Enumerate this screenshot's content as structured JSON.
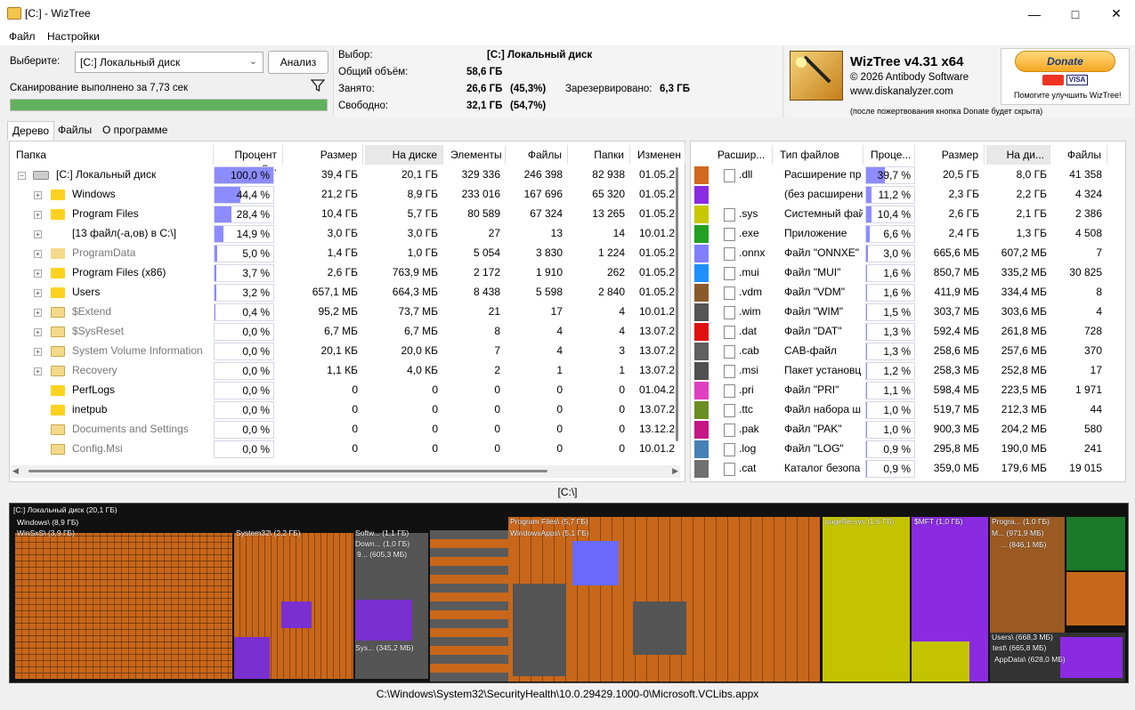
{
  "window": {
    "title": "[C:]  - WizTree"
  },
  "menu": [
    "Файл",
    "Настройки"
  ],
  "top": {
    "select_label": "Выберите:",
    "drive": "[C:] Локальный диск",
    "analyze": "Анализ",
    "scan_status": "Сканирование выполнено за 7,73 сек",
    "progress": 1.0
  },
  "info": {
    "sel_label": "Выбор:",
    "sel_value": "[C:]  Локальный диск",
    "total_label": "Общий объём:",
    "total": "58,6 ГБ",
    "used_label": "Занято:",
    "used": "26,6 ГБ",
    "used_pct": "(45,3%)",
    "reserved_label": "Зарезервировано:",
    "reserved": "6,3 ГБ",
    "free_label": "Свободно:",
    "free": "32,1 ГБ",
    "free_pct": "(54,7%)"
  },
  "brand": {
    "name": "WizTree v4.31 x64",
    "copy": "© 2026 Antibody Software",
    "site": "www.diskanalyzer.com",
    "donate": "Donate",
    "donate_help": "Помогите улучшить WizTree!",
    "donate_note": "(после пожертвования кнопка Donate будет скрыта)"
  },
  "tabs": [
    "Дерево",
    "Файлы",
    "О программе"
  ],
  "tree_headers": [
    "Папка",
    "Процент о...",
    "Размер",
    "На диске",
    "Элементы",
    "Файлы",
    "Папки",
    "Изменен"
  ],
  "tree_rows": [
    {
      "name": "[C:] Локальный диск",
      "pct": "100,0 %",
      "p": 1.0,
      "size": "39,4 ГБ",
      "disk": "20,1 ГБ",
      "items": "329 336",
      "files": "246 398",
      "folders": "82 938",
      "mod": "01.05.2",
      "type": "drive",
      "level": 0
    },
    {
      "name": "Windows",
      "pct": "44,4 %",
      "p": 0.444,
      "size": "21,2 ГБ",
      "disk": "8,9 ГБ",
      "items": "233 016",
      "files": "167 696",
      "folders": "65 320",
      "mod": "01.05.2",
      "type": "folder",
      "level": 1
    },
    {
      "name": "Program Files",
      "pct": "28,4 %",
      "p": 0.284,
      "size": "10,4 ГБ",
      "disk": "5,7 ГБ",
      "items": "80 589",
      "files": "67 324",
      "folders": "13 265",
      "mod": "01.05.2",
      "type": "folder",
      "level": 1
    },
    {
      "name": "[13 файл(-а,ов) в C:\\]",
      "pct": "14,9 %",
      "p": 0.149,
      "size": "3,0 ГБ",
      "disk": "3,0 ГБ",
      "items": "27",
      "files": "13",
      "folders": "14",
      "mod": "10.01.2",
      "type": "files",
      "level": 1
    },
    {
      "name": "ProgramData",
      "pct": "5,0 %",
      "p": 0.05,
      "size": "1,4 ГБ",
      "disk": "1,0 ГБ",
      "items": "5 054",
      "files": "3 830",
      "folders": "1 224",
      "mod": "01.05.2",
      "type": "hidden",
      "level": 1
    },
    {
      "name": "Program Files (x86)",
      "pct": "3,7 %",
      "p": 0.037,
      "size": "2,6 ГБ",
      "disk": "763,9 МБ",
      "items": "2 172",
      "files": "1 910",
      "folders": "262",
      "mod": "01.05.2",
      "type": "folder",
      "level": 1
    },
    {
      "name": "Users",
      "pct": "3,2 %",
      "p": 0.032,
      "size": "657,1 МБ",
      "disk": "664,3 МБ",
      "items": "8 438",
      "files": "5 598",
      "folders": "2 840",
      "mod": "01.05.2",
      "type": "folder",
      "level": 1
    },
    {
      "name": "$Extend",
      "pct": "0,4 %",
      "p": 0.004,
      "size": "95,2 МБ",
      "disk": "73,7 МБ",
      "items": "21",
      "files": "17",
      "folders": "4",
      "mod": "10.01.2",
      "type": "system",
      "level": 1
    },
    {
      "name": "$SysReset",
      "pct": "0,0 %",
      "p": 0,
      "size": "6,7 МБ",
      "disk": "6,7 МБ",
      "items": "8",
      "files": "4",
      "folders": "4",
      "mod": "13.07.2",
      "type": "system",
      "level": 1
    },
    {
      "name": "System Volume Information",
      "pct": "0,0 %",
      "p": 0,
      "size": "20,1 КБ",
      "disk": "20,0 КБ",
      "items": "7",
      "files": "4",
      "folders": "3",
      "mod": "13.07.2",
      "type": "system",
      "level": 1
    },
    {
      "name": "Recovery",
      "pct": "0,0 %",
      "p": 0,
      "size": "1,1 КБ",
      "disk": "4,0 КБ",
      "items": "2",
      "files": "1",
      "folders": "1",
      "mod": "13.07.2",
      "type": "system",
      "level": 1
    },
    {
      "name": "PerfLogs",
      "pct": "0,0 %",
      "p": 0,
      "size": "0",
      "disk": "0",
      "items": "0",
      "files": "0",
      "folders": "0",
      "mod": "01.04.2",
      "type": "folder",
      "level": 1
    },
    {
      "name": "inetpub",
      "pct": "0,0 %",
      "p": 0,
      "size": "0",
      "disk": "0",
      "items": "0",
      "files": "0",
      "folders": "0",
      "mod": "13.07.2",
      "type": "folder",
      "level": 1
    },
    {
      "name": "Documents and Settings",
      "pct": "0,0 %",
      "p": 0,
      "size": "0",
      "disk": "0",
      "items": "0",
      "files": "0",
      "folders": "0",
      "mod": "13.12.2",
      "type": "system",
      "level": 1
    },
    {
      "name": "Config.Msi",
      "pct": "0,0 %",
      "p": 0,
      "size": "0",
      "disk": "0",
      "items": "0",
      "files": "0",
      "folders": "0",
      "mod": "10.01.2",
      "type": "system",
      "level": 1
    }
  ],
  "ext_headers": [
    "Расшир...",
    "Тип файлов",
    "Проце...",
    "Размер",
    "На ди...",
    "Файлы"
  ],
  "ext_rows": [
    {
      "color": "#d2691e",
      "ext": ".dll",
      "type": "Расширение пр",
      "pct": "39,7 %",
      "p": 0.397,
      "size": "20,5 ГБ",
      "disk": "8,0 ГБ",
      "files": "41 358"
    },
    {
      "color": "#8a2be2",
      "ext": "",
      "type": "(без расширени",
      "pct": "11,2 %",
      "p": 0.112,
      "size": "2,3 ГБ",
      "disk": "2,2 ГБ",
      "files": "4 324"
    },
    {
      "color": "#c8c800",
      "ext": ".sys",
      "type": "Системный фай",
      "pct": "10,4 %",
      "p": 0.104,
      "size": "2,6 ГБ",
      "disk": "2,1 ГБ",
      "files": "2 386"
    },
    {
      "color": "#22a022",
      "ext": ".exe",
      "type": "Приложение",
      "pct": "6,6 %",
      "p": 0.066,
      "size": "2,4 ГБ",
      "disk": "1,3 ГБ",
      "files": "4 508"
    },
    {
      "color": "#8080ff",
      "ext": ".onnx",
      "type": "Файл \"ONNXE\"",
      "pct": "3,0 %",
      "p": 0.03,
      "size": "665,6 МБ",
      "disk": "607,2 МБ",
      "files": "7"
    },
    {
      "color": "#1e90ff",
      "ext": ".mui",
      "type": "Файл \"MUI\"",
      "pct": "1,6 %",
      "p": 0.016,
      "size": "850,7 МБ",
      "disk": "335,2 МБ",
      "files": "30 825"
    },
    {
      "color": "#8b5a2b",
      "ext": ".vdm",
      "type": "Файл \"VDM\"",
      "pct": "1,6 %",
      "p": 0.016,
      "size": "411,9 МБ",
      "disk": "334,4 МБ",
      "files": "8"
    },
    {
      "color": "#555555",
      "ext": ".wim",
      "type": "Файл \"WIM\"",
      "pct": "1,5 %",
      "p": 0.015,
      "size": "303,7 МБ",
      "disk": "303,6 МБ",
      "files": "4"
    },
    {
      "color": "#e01010",
      "ext": ".dat",
      "type": "Файл \"DAT\"",
      "pct": "1,3 %",
      "p": 0.013,
      "size": "592,4 МБ",
      "disk": "261,8 МБ",
      "files": "728"
    },
    {
      "color": "#606060",
      "ext": ".cab",
      "type": "CAB-файл",
      "pct": "1,3 %",
      "p": 0.013,
      "size": "258,6 МБ",
      "disk": "257,6 МБ",
      "files": "370"
    },
    {
      "color": "#505050",
      "ext": ".msi",
      "type": "Пакет установц",
      "pct": "1,2 %",
      "p": 0.012,
      "size": "258,3 МБ",
      "disk": "252,8 МБ",
      "files": "17"
    },
    {
      "color": "#e040c0",
      "ext": ".pri",
      "type": "Файл \"PRI\"",
      "pct": "1,1 %",
      "p": 0.011,
      "size": "598,4 МБ",
      "disk": "223,5 МБ",
      "files": "1 971"
    },
    {
      "color": "#6b8e23",
      "ext": ".ttc",
      "type": "Файл набора ш",
      "pct": "1,0 %",
      "p": 0.01,
      "size": "519,7 МБ",
      "disk": "212,3 МБ",
      "files": "44"
    },
    {
      "color": "#c71585",
      "ext": ".pak",
      "type": "Файл \"PAK\"",
      "pct": "1,0 %",
      "p": 0.01,
      "size": "900,3 МБ",
      "disk": "204,2 МБ",
      "files": "580"
    },
    {
      "color": "#4682b4",
      "ext": ".log",
      "type": "Файл \"LOG\"",
      "pct": "0,9 %",
      "p": 0.009,
      "size": "295,8 МБ",
      "disk": "190,0 МБ",
      "files": "241"
    },
    {
      "color": "#707070",
      "ext": ".cat",
      "type": "Каталог безопа",
      "pct": "0,9 %",
      "p": 0.009,
      "size": "359,0 МБ",
      "disk": "179,6 МБ",
      "files": "19 015"
    }
  ],
  "treemap_path": "[C:\\]",
  "treemap_labels": [
    "[C:] Локальный диск  (20,1 ГБ)",
    "Windows\\ (8,9 ГБ)",
    "WinSxS\\ (3,9 ГБ)",
    "System32\\ (2,2 ГБ)",
    "Softw... (1,1 ГБ)",
    "Down... (1,0 ГБ)",
    "9... (605,3 МБ)",
    "Sys... (345,2 МБ)",
    "Program Files\\ (5,7 ГБ)",
    "WindowsApps\\ (5,1 ГБ)",
    "pagefile.sys (1,6 ГБ)",
    "$MFT (1,0 ГБ)",
    "Progra... (1,0 ГБ)",
    "M... (971,9 МБ)",
    "... (846,1 МБ)",
    "Users\\ (668,3 МБ)",
    "test\\ (665,8 МБ)",
    "AppData\\ (628,0 МБ)"
  ],
  "status": "C:\\Windows\\System32\\SecurityHealth\\10.0.29429.1000-0\\Microsoft.VCLibs.appx"
}
